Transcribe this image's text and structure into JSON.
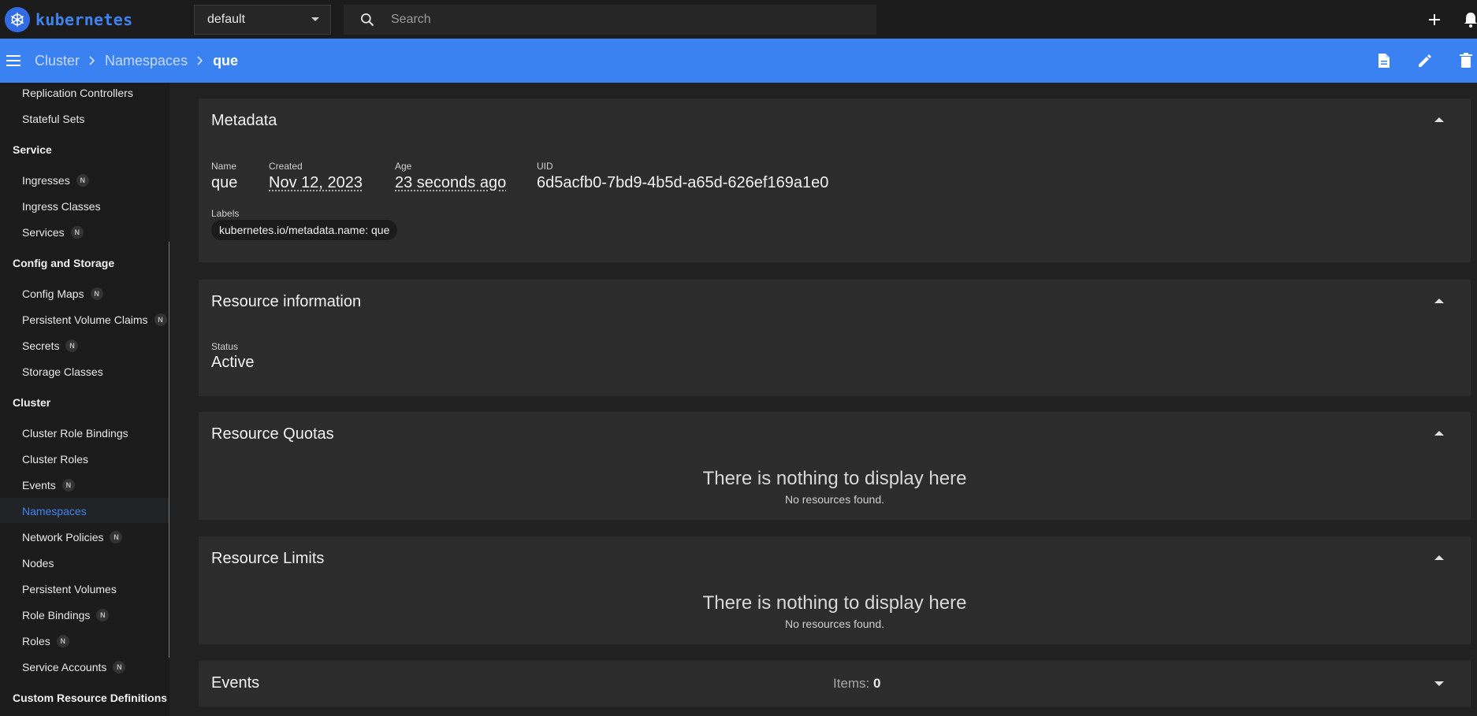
{
  "brand": {
    "name": "kubernetes"
  },
  "namespace_select": {
    "value": "default"
  },
  "search": {
    "placeholder": "Search"
  },
  "breadcrumb": {
    "items": [
      "Cluster",
      "Namespaces"
    ],
    "current": "que"
  },
  "sidebar": {
    "items": [
      {
        "type": "item",
        "label": "Replication Controllers"
      },
      {
        "type": "item",
        "label": "Stateful Sets"
      },
      {
        "type": "section",
        "label": "Service"
      },
      {
        "type": "item",
        "label": "Ingresses",
        "badge": "N"
      },
      {
        "type": "item",
        "label": "Ingress Classes"
      },
      {
        "type": "item",
        "label": "Services",
        "badge": "N"
      },
      {
        "type": "section",
        "label": "Config and Storage"
      },
      {
        "type": "item",
        "label": "Config Maps",
        "badge": "N"
      },
      {
        "type": "item",
        "label": "Persistent Volume Claims",
        "badge": "N"
      },
      {
        "type": "item",
        "label": "Secrets",
        "badge": "N"
      },
      {
        "type": "item",
        "label": "Storage Classes"
      },
      {
        "type": "section",
        "label": "Cluster"
      },
      {
        "type": "item",
        "label": "Cluster Role Bindings"
      },
      {
        "type": "item",
        "label": "Cluster Roles"
      },
      {
        "type": "item",
        "label": "Events",
        "badge": "N"
      },
      {
        "type": "item",
        "label": "Namespaces",
        "active": true
      },
      {
        "type": "item",
        "label": "Network Policies",
        "badge": "N"
      },
      {
        "type": "item",
        "label": "Nodes"
      },
      {
        "type": "item",
        "label": "Persistent Volumes"
      },
      {
        "type": "item",
        "label": "Role Bindings",
        "badge": "N"
      },
      {
        "type": "item",
        "label": "Roles",
        "badge": "N"
      },
      {
        "type": "item",
        "label": "Service Accounts",
        "badge": "N"
      },
      {
        "type": "section",
        "label": "Custom Resource Definitions"
      }
    ]
  },
  "metadata": {
    "title": "Metadata",
    "name_label": "Name",
    "name": "que",
    "created_label": "Created",
    "created": "Nov 12, 2023",
    "age_label": "Age",
    "age": "23 seconds ago",
    "uid_label": "UID",
    "uid": "6d5acfb0-7bd9-4b5d-a65d-626ef169a1e0",
    "labels_label": "Labels",
    "label_chip": "kubernetes.io/metadata.name: que"
  },
  "resource_info": {
    "title": "Resource information",
    "status_label": "Status",
    "status": "Active"
  },
  "resource_quotas": {
    "title": "Resource Quotas",
    "empty_title": "There is nothing to display here",
    "empty_sub": "No resources found."
  },
  "resource_limits": {
    "title": "Resource Limits",
    "empty_title": "There is nothing to display here",
    "empty_sub": "No resources found."
  },
  "events": {
    "title": "Events",
    "items_label": "Items:",
    "items_count": "0"
  },
  "colors": {
    "accent": "#3a81f1",
    "topbar": "#1b1b1b",
    "card": "#2c2c2c",
    "background": "#212121"
  }
}
